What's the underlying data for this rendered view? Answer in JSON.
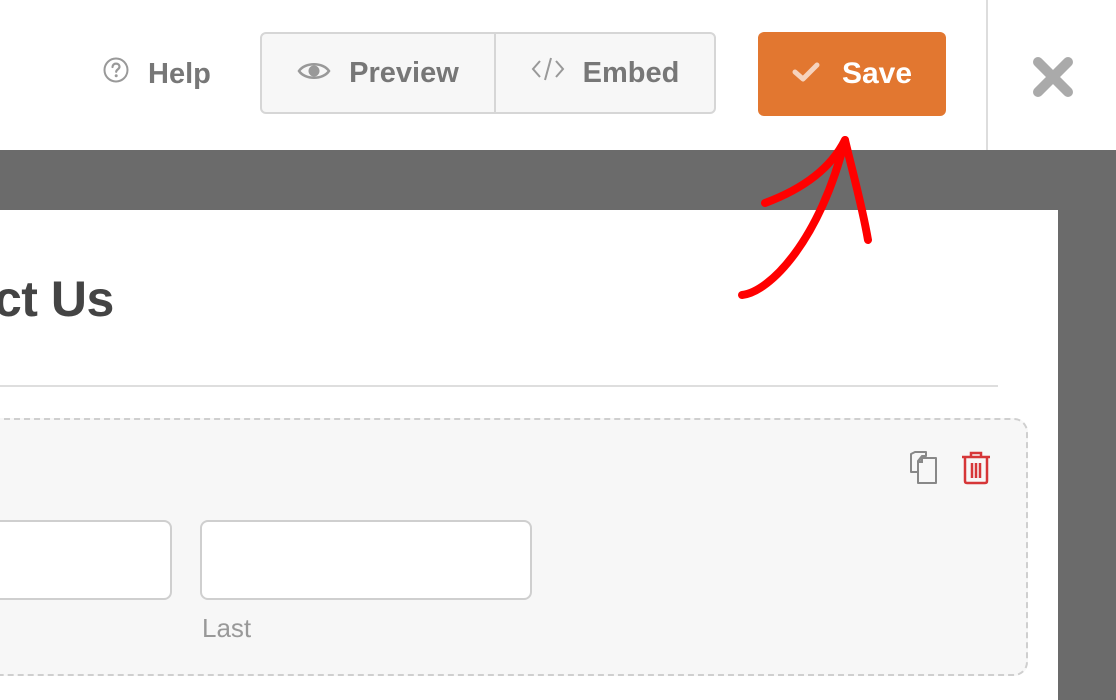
{
  "header": {
    "help_label": "Help",
    "preview_label": "Preview",
    "embed_label": "Embed",
    "save_label": "Save",
    "icons": {
      "help": "question-circle-icon",
      "preview": "eye-icon",
      "embed": "code-icon",
      "save": "check-icon",
      "close": "close-icon"
    }
  },
  "form": {
    "title_partial": "ct Us",
    "field": {
      "first_value": "",
      "last_value": "",
      "last_sublabel": "Last",
      "icons": {
        "duplicate": "duplicate-icon",
        "delete": "trash-icon"
      }
    }
  },
  "annotation": {
    "type": "red-arrow",
    "points_to": "save-button",
    "color": "#ff0000"
  },
  "colors": {
    "accent": "#e27730",
    "delete": "#d63638",
    "canvas": "#6b6b6b",
    "text_muted": "#777777"
  }
}
